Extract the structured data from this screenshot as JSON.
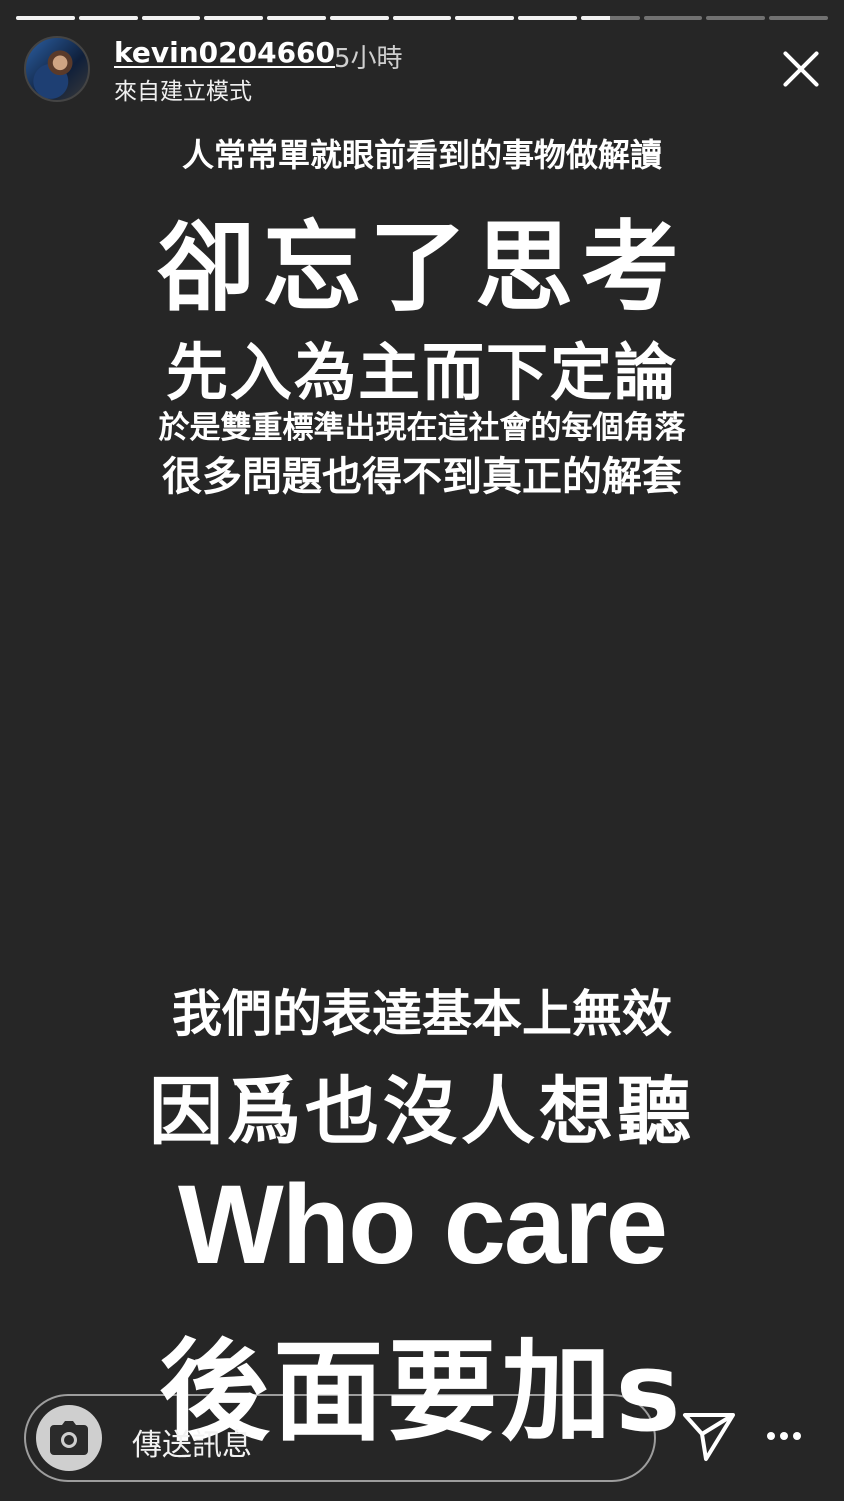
{
  "progress": {
    "segments": 13,
    "completed": 9,
    "current_fraction": 0.5
  },
  "header": {
    "username": "kevin0204660",
    "time": "5小時",
    "subtitle": "來自建立模式"
  },
  "story": {
    "lines": [
      "人常常單就眼前看到的事物做解讀",
      "卻忘了思考",
      "先入為主而下定論",
      "於是雙重標準出現在這社會的每個角落",
      "很多問題也得不到真正的解套",
      "我們的表達基本上無效",
      "因爲也沒人想聽",
      "Who care",
      "後面要加s"
    ]
  },
  "composer": {
    "placeholder": "傳送訊息"
  },
  "icons": {
    "camera": "camera-icon",
    "send": "send-icon",
    "more": "more-icon",
    "close": "close-icon"
  },
  "colors": {
    "background": "#262626",
    "text": "#ffffff"
  }
}
